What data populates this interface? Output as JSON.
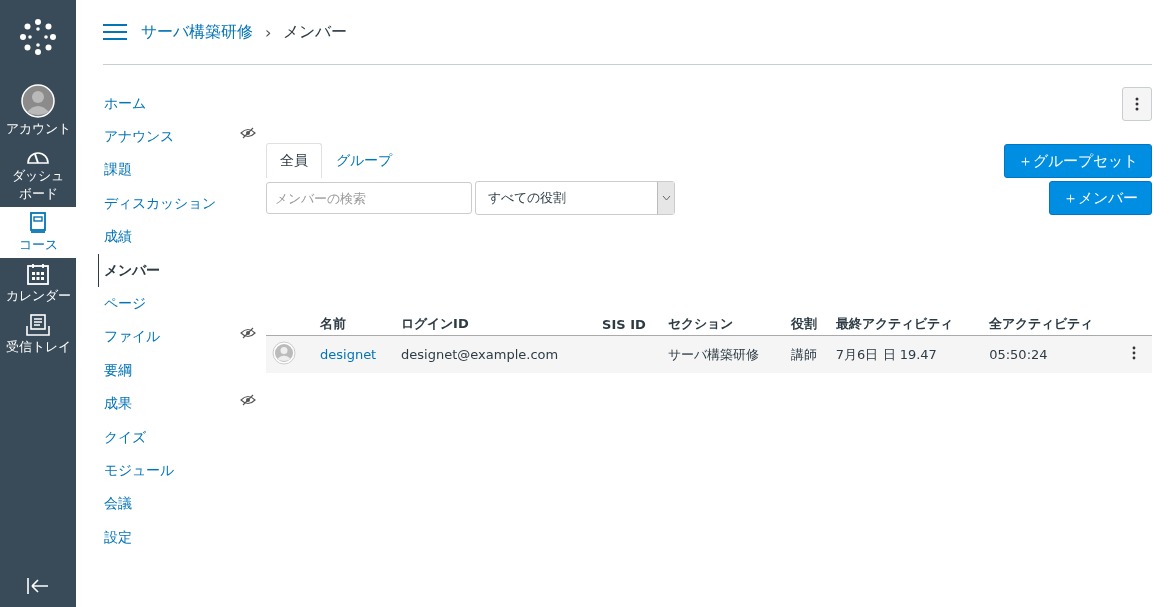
{
  "global_nav": [
    {
      "kind": "account",
      "label": "アカウント",
      "selected": false
    },
    {
      "kind": "dashboard",
      "label": "ダッシュボード",
      "selected": false
    },
    {
      "kind": "courses",
      "label": "コース",
      "selected": true
    },
    {
      "kind": "calendar",
      "label": "カレンダー",
      "selected": false
    },
    {
      "kind": "inbox",
      "label": "受信トレイ",
      "selected": false
    }
  ],
  "breadcrumb": {
    "course": "サーバ構築研修",
    "separator": "›",
    "page": "メンバー"
  },
  "course_nav": [
    {
      "label": "ホーム",
      "selected": false,
      "hidden": false
    },
    {
      "label": "アナウンス",
      "selected": false,
      "hidden": true
    },
    {
      "label": "課題",
      "selected": false,
      "hidden": false
    },
    {
      "label": "ディスカッション",
      "selected": false,
      "hidden": false
    },
    {
      "label": "成績",
      "selected": false,
      "hidden": false
    },
    {
      "label": "メンバー",
      "selected": true,
      "hidden": false
    },
    {
      "label": "ページ",
      "selected": false,
      "hidden": false
    },
    {
      "label": "ファイル",
      "selected": false,
      "hidden": true
    },
    {
      "label": "要綱",
      "selected": false,
      "hidden": false
    },
    {
      "label": "成果",
      "selected": false,
      "hidden": true
    },
    {
      "label": "クイズ",
      "selected": false,
      "hidden": false
    },
    {
      "label": "モジュール",
      "selected": false,
      "hidden": false
    },
    {
      "label": "会議",
      "selected": false,
      "hidden": false
    },
    {
      "label": "設定",
      "selected": false,
      "hidden": false
    }
  ],
  "tabs": [
    {
      "label": "全員",
      "selected": true
    },
    {
      "label": "グループ",
      "selected": false
    }
  ],
  "search": {
    "placeholder": "メンバーの検索"
  },
  "role_filter": {
    "value": "すべての役割"
  },
  "buttons": {
    "group_set": "＋グループセット",
    "member": "＋メンバー"
  },
  "table": {
    "columns": [
      "名前",
      "ログインID",
      "SIS ID",
      "セクション",
      "役割",
      "最終アクティビティ",
      "全アクティビティ"
    ],
    "rows": [
      {
        "name": "designet",
        "login_id": "designet@example.com",
        "sis_id": "",
        "section": "サーバ構築研修",
        "role": "講師",
        "last_activity": "7月6日 日 19.47",
        "total_activity": "05:50:24"
      }
    ]
  }
}
